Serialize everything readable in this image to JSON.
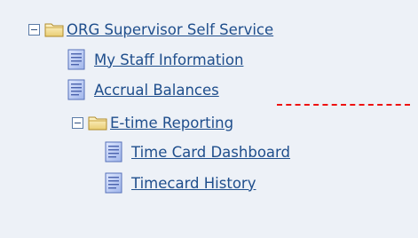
{
  "tree": {
    "root": {
      "label": "ORG Supervisor Self Service",
      "expanded": true,
      "icon": "folder-icon"
    },
    "items": [
      {
        "label": "My Staff Information",
        "icon": "document-icon"
      },
      {
        "label": "Accrual Balances",
        "icon": "document-icon"
      },
      {
        "label": "E-time Reporting",
        "icon": "folder-icon",
        "expanded": true,
        "children": [
          {
            "label": "Time Card Dashboard",
            "icon": "document-icon"
          },
          {
            "label": "Timecard History",
            "icon": "document-icon"
          }
        ]
      }
    ]
  },
  "colors": {
    "background": "#edf1f7",
    "link": "#1f4e8c",
    "annotation_line": "#e11111"
  }
}
